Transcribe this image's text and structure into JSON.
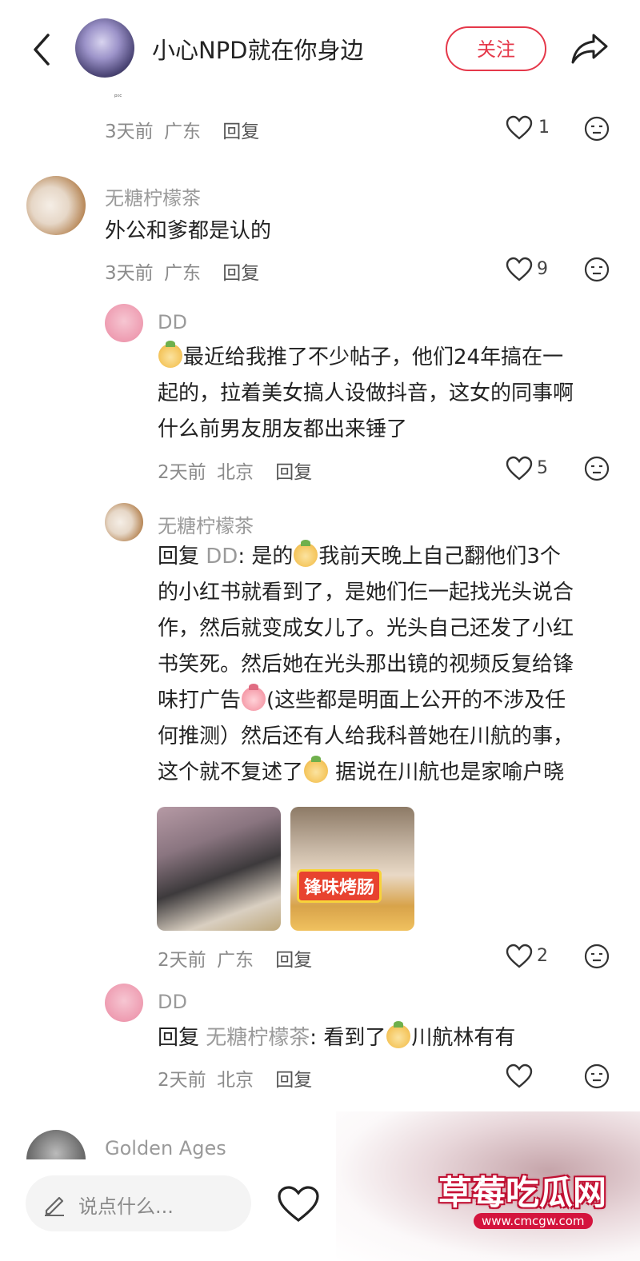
{
  "header": {
    "title": "小心NPD就在你身边",
    "follow_label": "关注",
    "tiny_mark": "ᵖᶦᶜ"
  },
  "comments": [
    {
      "meta_time": "3天前",
      "meta_loc": "广东",
      "reply_label": "回复",
      "likes": "1"
    },
    {
      "author": "无糖柠檬茶",
      "text": "外公和爹都是认的",
      "meta_time": "3天前",
      "meta_loc": "广东",
      "reply_label": "回复",
      "likes": "9"
    },
    {
      "author": "DD",
      "text_lines": [
        "最近给我推了不少帖子，他们24年搞在一",
        "起的，拉着美女搞人设做抖音，这女的同事啊",
        "什么前男友朋友都出来锤了"
      ],
      "meta_time": "2天前",
      "meta_loc": "北京",
      "reply_label": "回复",
      "likes": "5"
    },
    {
      "author": "无糖柠檬茶",
      "reply_prefix": "回复",
      "reply_to": "DD",
      "l1a": ": 是的",
      "l1b": "我前天晚上自己翻他们3个",
      "l2": "的小红书就看到了，是她们仨一起找光头说合",
      "l3": "作，然后就变成女儿了。光头自己还发了小红",
      "l4": "书笑死。然后她在光头那出镜的视频反复给锋",
      "l5a": "味打广告",
      "l5b": "(这些都是明面上公开的不涉及任",
      "l6": "何推测）然后还有人给我科普她在川航的事，",
      "l7a": "这个就不复述了",
      "l7b": " 据说在川航也是家喻户晓",
      "image_caption": "锋味烤肠",
      "meta_time": "2天前",
      "meta_loc": "广东",
      "reply_label": "回复",
      "likes": "2"
    },
    {
      "author": "DD",
      "reply_prefix": "回复",
      "reply_to": "无糖柠檬茶",
      "text_a": ": 看到了",
      "text_b": "川航林有有",
      "meta_time": "2天前",
      "meta_loc": "北京",
      "reply_label": "回复"
    },
    {
      "author": "Golden Ages"
    }
  ],
  "bottom": {
    "input_placeholder": "说点什么..."
  },
  "watermark": {
    "title": "草莓吃瓜网",
    "url": "www.cmcgw.com"
  },
  "icons": [
    "chevron-left-icon",
    "share-icon",
    "heart-icon",
    "emoji-icon",
    "pencil-icon"
  ],
  "colors": {
    "accent": "#e5384a",
    "meta": "#8b8b8b",
    "name": "#9a9a9a"
  }
}
